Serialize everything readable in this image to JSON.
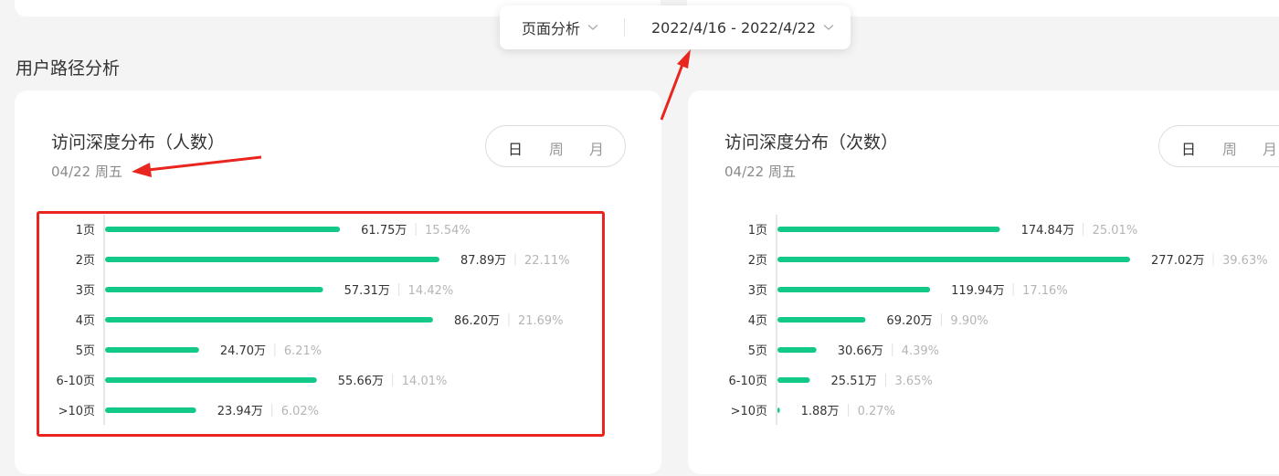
{
  "filter": {
    "page_label": "页面分析",
    "date_label": "2022/4/16 - 2022/4/22"
  },
  "section_title": "用户路径分析",
  "colors": {
    "bar": "#12c988",
    "highlight": "#e8251f",
    "arrow": "#e8251f"
  },
  "cards": [
    {
      "title": "访问深度分布（人数）",
      "date": "04/22 周五",
      "segments": [
        "日",
        "周",
        "月"
      ],
      "active_segment": 0
    },
    {
      "title": "访问深度分布（次数）",
      "date": "04/22 周五",
      "segments": [
        "日",
        "周",
        "月"
      ],
      "active_segment": 0
    }
  ],
  "chart_data": [
    {
      "type": "bar",
      "orientation": "horizontal",
      "categories": [
        "1页",
        "2页",
        "3页",
        "4页",
        "5页",
        "6-10页",
        ">10页"
      ],
      "values": [
        61.75,
        87.89,
        57.31,
        86.2,
        24.7,
        55.66,
        23.94
      ],
      "value_labels": [
        "61.75万",
        "87.89万",
        "57.31万",
        "86.20万",
        "24.70万",
        "55.66万",
        "23.94万"
      ],
      "percent_labels": [
        "15.54%",
        "22.11%",
        "14.42%",
        "21.69%",
        "6.21%",
        "14.01%",
        "6.02%"
      ],
      "unit": "万",
      "max": 87.89
    },
    {
      "type": "bar",
      "orientation": "horizontal",
      "categories": [
        "1页",
        "2页",
        "3页",
        "4页",
        "5页",
        "6-10页",
        ">10页"
      ],
      "values": [
        174.84,
        277.02,
        119.94,
        69.2,
        30.66,
        25.51,
        1.88
      ],
      "value_labels": [
        "174.84万",
        "277.02万",
        "119.94万",
        "69.20万",
        "30.66万",
        "25.51万",
        "1.88万"
      ],
      "percent_labels": [
        "25.01%",
        "39.63%",
        "17.16%",
        "9.90%",
        "4.39%",
        "3.65%",
        "0.27%"
      ],
      "unit": "万",
      "max": 277.02
    }
  ]
}
